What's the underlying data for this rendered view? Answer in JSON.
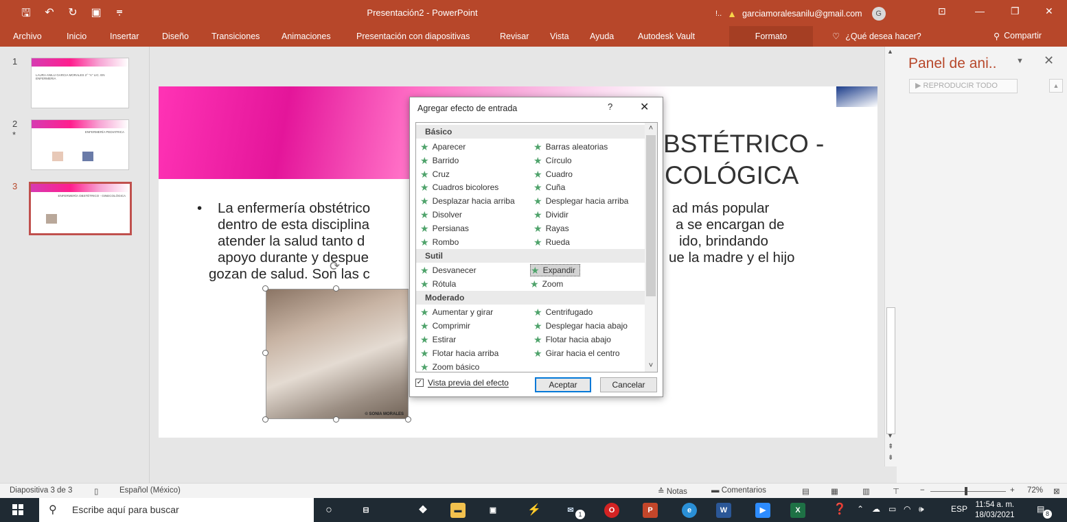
{
  "window": {
    "title": "Presentación2 - PowerPoint",
    "account_email": "garciamoralesanilu@gmail.com",
    "account_initial": "G",
    "warning_text": "!.."
  },
  "tabs": [
    "Archivo",
    "Inicio",
    "Insertar",
    "Diseño",
    "Transiciones",
    "Animaciones",
    "Presentación con diapositivas",
    "Revisar",
    "Vista",
    "Ayuda",
    "Autodesk Vault"
  ],
  "context_tab": "Formato",
  "tell_me": "¿Qué desea hacer?",
  "share": "Compartir",
  "thumbnails": {
    "numbers": [
      "1",
      "2",
      "3"
    ],
    "slide2_marker": "*",
    "slide1_text": "LAURA ANILU GARCIA MORALES 2° \"A\" LIC. EN ENFERMERIA",
    "slide2_text": "ENFERMERÍA PEDIATRICA",
    "slide3_text": "ENFERMERÍA OBSTÉTRICO - GINECOLÓGICA"
  },
  "slide": {
    "title_line1": "BSTÉTRICO -",
    "title_line2": "COLÓGICA",
    "bullet": "•",
    "body_lines": [
      [
        "La enfermería obstétrico",
        "ad más popular"
      ],
      [
        "dentro de esta disciplina",
        "a se encargan de"
      ],
      [
        "atender la salud tanto d",
        "ido, brindando"
      ],
      [
        "apoyo durante y despue",
        "ue la madre y el hijo"
      ],
      [
        "gozan de salud. Son las c",
        ""
      ]
    ],
    "photo_credit": "© SONIA MORALES"
  },
  "dialog": {
    "title": "Agregar efecto de entrada",
    "help": "?",
    "close": "✕",
    "categories": {
      "basic": "Básico",
      "subtle": "Sutil",
      "moderate": "Moderado"
    },
    "basic_left": [
      "Aparecer",
      "Barrido",
      "Cruz",
      "Cuadros bicolores",
      "Desplazar hacia arriba",
      "Disolver",
      "Persianas",
      "Rombo"
    ],
    "basic_right": [
      "Barras aleatorias",
      "Círculo",
      "Cuadro",
      "Cuña",
      "Desplegar hacia arriba",
      "Dividir",
      "Rayas",
      "Rueda"
    ],
    "subtle_left": [
      "Desvanecer",
      "Rótula"
    ],
    "subtle_right": [
      "Expandir",
      "Zoom"
    ],
    "moderate_left": [
      "Aumentar y girar",
      "Comprimir",
      "Estirar",
      "Flotar hacia arriba",
      "Zoom básico"
    ],
    "moderate_right": [
      "Centrifugado",
      "Desplegar hacia abajo",
      "Flotar hacia abajo",
      "Girar hacia el centro"
    ],
    "selected_effect": "Expandir",
    "preview_label": "Vista previa del efecto",
    "preview_checked": true,
    "ok": "Aceptar",
    "cancel": "Cancelar"
  },
  "animation_pane": {
    "title": "Panel de ani..",
    "play_all": "REPRODUCIR TODO"
  },
  "statusbar": {
    "slide_info": "Diapositiva 3 de 3",
    "language": "Español (México)",
    "notes": "Notas",
    "comments": "Comentarios",
    "zoom": "72%"
  },
  "taskbar": {
    "search_placeholder": "Escribe aquí para buscar",
    "mail_badge": "1",
    "lang": "ESP",
    "time": "11:54 a. m.",
    "date": "18/03/2021",
    "notif_count": "8"
  },
  "colors": {
    "accent": "#b7472a",
    "selected_border": "#c0504d",
    "effect_star": "#4fa36b"
  }
}
